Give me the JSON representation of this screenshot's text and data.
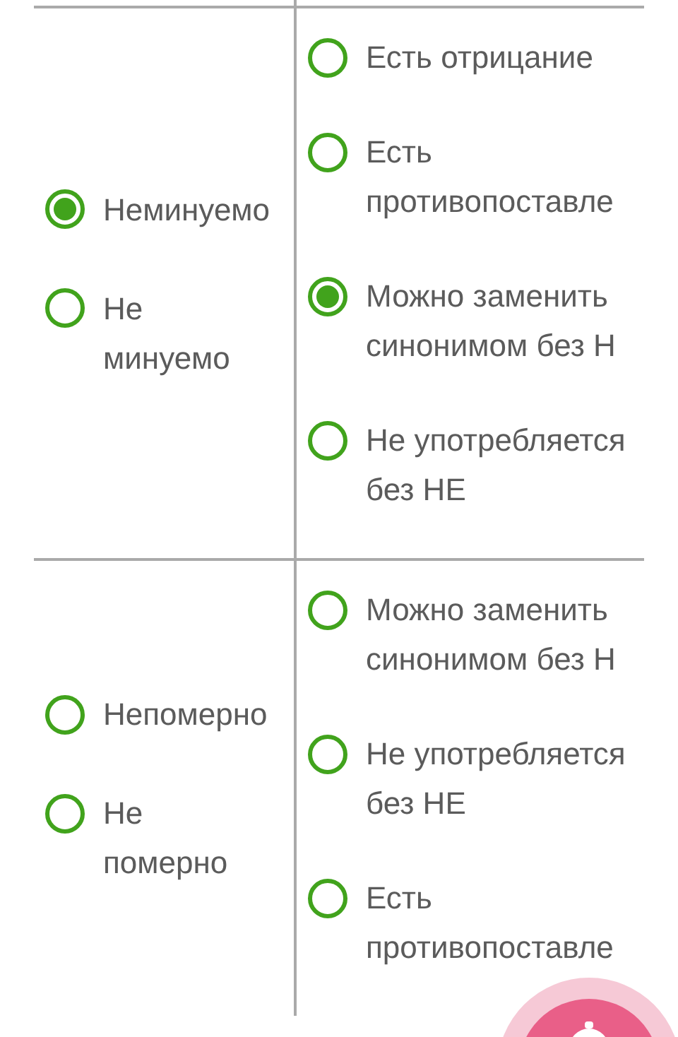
{
  "questions": [
    {
      "words": [
        {
          "label": "Неминуемо",
          "selected": true
        },
        {
          "label": "Не минуемо",
          "selected": false
        }
      ],
      "criteria": [
        {
          "label": "Есть отрицание",
          "selected": false
        },
        {
          "label": "Есть противопоставле",
          "selected": false
        },
        {
          "label": "Можно заменить синонимом без Н",
          "selected": true
        },
        {
          "label": "Не употребляется без НЕ",
          "selected": false
        }
      ]
    },
    {
      "words": [
        {
          "label": "Непомерно",
          "selected": false
        },
        {
          "label": "Не померно",
          "selected": false
        }
      ],
      "criteria": [
        {
          "label": "Можно заменить синонимом без Н",
          "selected": false
        },
        {
          "label": "Не употребляется без НЕ",
          "selected": false
        },
        {
          "label": "Есть противопоставле",
          "selected": false
        }
      ]
    }
  ],
  "fab": {
    "kind": "button"
  }
}
